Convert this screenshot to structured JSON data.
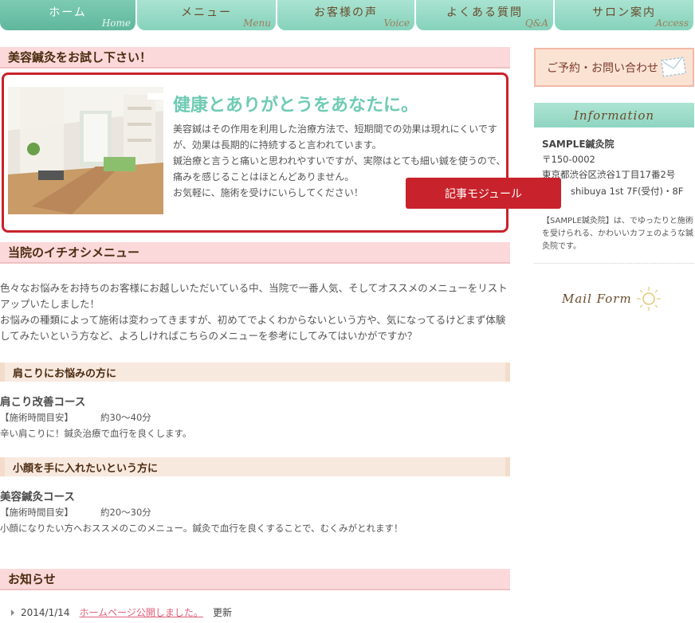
{
  "nav": [
    {
      "label": "ホーム",
      "sub": "Home",
      "active": true
    },
    {
      "label": "メニュー",
      "sub": "Menu",
      "active": false
    },
    {
      "label": "お客様の声",
      "sub": "Voice",
      "active": false
    },
    {
      "label": "よくある質問",
      "sub": "Q&A",
      "active": false
    },
    {
      "label": "サロン案内",
      "sub": "Access",
      "active": false
    }
  ],
  "intro": {
    "heading": "美容鍼灸をお試し下さい！",
    "title": "健康とありがとうをあなたに。",
    "body": "美容鍼はその作用を利用した治療方法で、短期間での効果は現れにくいですが、効果は長期的に持続すると言われています。\n鍼治療と言うと痛いと思われやすいですが、実際はとても細い鍼を使うので、痛みを感じることはほとんどありません。\nお気軽に、施術を受けにいらしてください！",
    "module_label": "記事モジュール"
  },
  "recommend": {
    "heading": "当院のイチオシメニュー",
    "para": "色々なお悩みをお持ちのお客様にお越しいただいている中、当院で一番人気、そしてオススメのメニューをリストアップいたしました！\nお悩みの種類によって施術は変わってきますが、初めてでよくわからないという方や、気になってるけどまず体験してみたいという方など、よろしければこちらのメニューを参考にしてみてはいかがですか？"
  },
  "courses": [
    {
      "category": "肩こりにお悩みの方に",
      "name": "肩こり改善コース",
      "meta_label": "【施術時間目安】",
      "meta_value": "約30〜40分",
      "desc": "辛い肩こりに！鍼灸治療で血行を良くします。"
    },
    {
      "category": "小顔を手に入れたいという方に",
      "name": "美容鍼灸コース",
      "meta_label": "【施術時間目安】",
      "meta_value": "約20〜30分",
      "desc": "小顔になりたい方へおススメのこのメニュー。鍼灸で血行を良くすることで、むくみがとれます！"
    }
  ],
  "news": {
    "heading": "お知らせ",
    "items": [
      {
        "date": "2014/1/14",
        "link": "ホームページ公開しました。",
        "suffix": "更新"
      }
    ]
  },
  "sidebar": {
    "contact_label": "ご予約・お問い合わせ",
    "info_title": "Information",
    "clinic_name": "SAMPLE鍼灸院",
    "postal": "〒150-0002",
    "address1": "東京都渋谷区渋谷1丁目17番2号",
    "address2": "shibuya 1st 7F(受付)・8F",
    "description": "【SAMPLE鍼灸院】は、でゆったりと施術を受けられる、かわいいカフェのような鍼灸院です。",
    "mailform_label": "Mail Form"
  },
  "colors": {
    "accent_mint": "#86d2bb",
    "heading_pink": "#fbd9da",
    "badge_red": "#c8232c",
    "link_pink": "#e0607a"
  }
}
